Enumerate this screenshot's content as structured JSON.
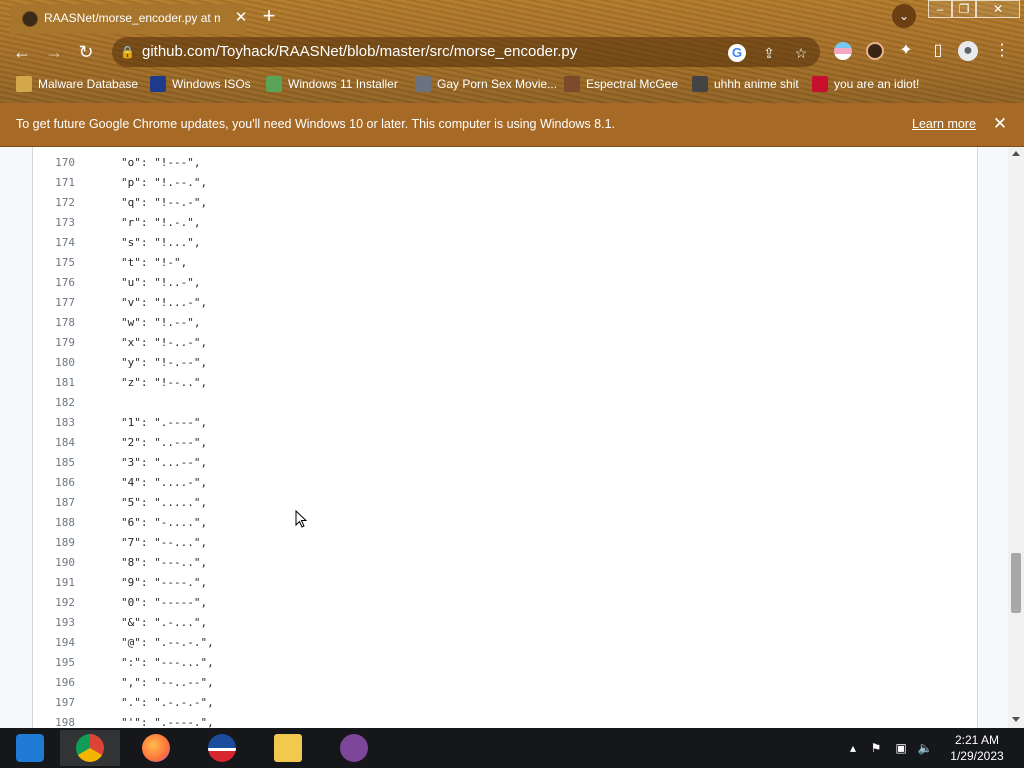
{
  "browser": {
    "tab_title": "RAASNet/morse_encoder.py at m",
    "url": "github.com/Toyhack/RAASNet/blob/master/src/morse_encoder.py",
    "bookmarks": [
      {
        "label": "Malware Database",
        "icon": "folder-icon",
        "color": "#d4a94c"
      },
      {
        "label": "Windows ISOs",
        "icon": "x-logo-icon",
        "color": "#1e3a8a"
      },
      {
        "label": "Windows 11 Installer",
        "icon": "image-icon",
        "color": "#5aa45a"
      },
      {
        "label": "Gay Porn Sex Movie...",
        "icon": "dice-icon",
        "color": "#6b7280"
      },
      {
        "label": "Espectral McGee",
        "icon": "face-icon",
        "color": "#7a4a2a"
      },
      {
        "label": "uhhh anime shit",
        "icon": "anime-icon",
        "color": "#444444"
      },
      {
        "label": "you are an idiot!",
        "icon": "uk-flag-icon",
        "color": "#c8102e"
      }
    ]
  },
  "infobar": {
    "message": "To get future Google Chrome updates, you'll need Windows 10 or later. This computer is using Windows 8.1.",
    "link": "Learn more"
  },
  "code_lines": [
    {
      "num": "170",
      "text": "\"o\": \"!---\","
    },
    {
      "num": "171",
      "text": "\"p\": \"!.--.\","
    },
    {
      "num": "172",
      "text": "\"q\": \"!--.-\","
    },
    {
      "num": "173",
      "text": "\"r\": \"!.-.\","
    },
    {
      "num": "174",
      "text": "\"s\": \"!...\","
    },
    {
      "num": "175",
      "text": "\"t\": \"!-\","
    },
    {
      "num": "176",
      "text": "\"u\": \"!..-\","
    },
    {
      "num": "177",
      "text": "\"v\": \"!...-\","
    },
    {
      "num": "178",
      "text": "\"w\": \"!.--\","
    },
    {
      "num": "179",
      "text": "\"x\": \"!-..-\","
    },
    {
      "num": "180",
      "text": "\"y\": \"!-.--\","
    },
    {
      "num": "181",
      "text": "\"z\": \"!--..\","
    },
    {
      "num": "182",
      "text": ""
    },
    {
      "num": "183",
      "text": "\"1\": \".----\","
    },
    {
      "num": "184",
      "text": "\"2\": \"..---\","
    },
    {
      "num": "185",
      "text": "\"3\": \"...--\","
    },
    {
      "num": "186",
      "text": "\"4\": \"....-\","
    },
    {
      "num": "187",
      "text": "\"5\": \".....\","
    },
    {
      "num": "188",
      "text": "\"6\": \"-....\","
    },
    {
      "num": "189",
      "text": "\"7\": \"--...\","
    },
    {
      "num": "190",
      "text": "\"8\": \"---..\","
    },
    {
      "num": "191",
      "text": "\"9\": \"----.\","
    },
    {
      "num": "192",
      "text": "\"0\": \"-----\","
    },
    {
      "num": "193",
      "text": "\"&\": \".-...\","
    },
    {
      "num": "194",
      "text": "\"@\": \".--.-.\","
    },
    {
      "num": "195",
      "text": "\":\": \"---...\","
    },
    {
      "num": "196",
      "text": "\",\": \"--..--\","
    },
    {
      "num": "197",
      "text": "\".\": \".-.-.-\","
    },
    {
      "num": "198",
      "text": "\"'\": \".----.\","
    }
  ],
  "taskbar": {
    "apps": [
      {
        "name": "taskbar-item-windows",
        "color": "#1f7ad6"
      },
      {
        "name": "taskbar-item-chrome",
        "color": "#db4437"
      },
      {
        "name": "taskbar-item-firefox",
        "color": "#ff7139"
      },
      {
        "name": "taskbar-item-obama",
        "color": "#1b4c9b"
      },
      {
        "name": "taskbar-item-file-explorer",
        "color": "#f2c94c"
      },
      {
        "name": "taskbar-item-tor",
        "color": "#7d4698"
      }
    ],
    "time": "2:21 AM",
    "date": "1/29/2023"
  }
}
